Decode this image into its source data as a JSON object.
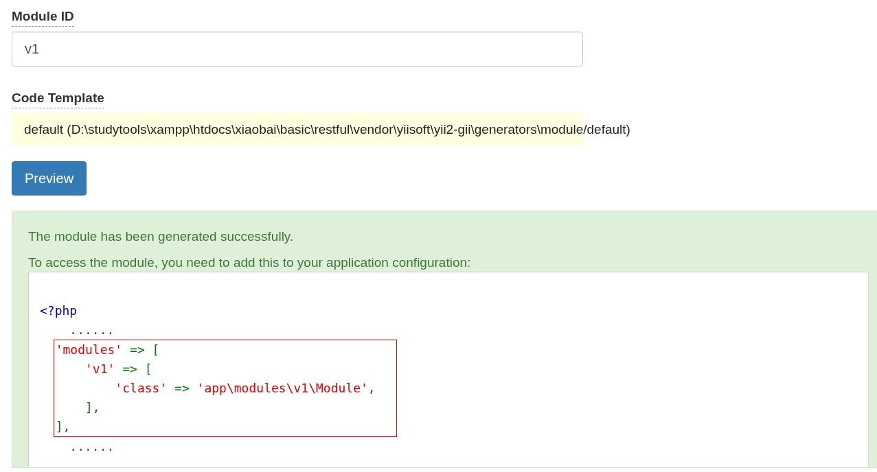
{
  "fields": [
    {
      "kind": "input",
      "label": "Module ID",
      "value": "v1"
    },
    {
      "kind": "sticky",
      "label": "Code Template",
      "value": "default (D:\\studytools\\xampp\\htdocs\\xiaobai\\basic\\restful\\vendor\\yiisoft\\yii2-gii\\generators\\module/default)"
    }
  ],
  "preview_button": "Preview",
  "alert": {
    "messages": [
      "The module has been generated successfully.",
      "To access the module, you need to add this to your application configuration:"
    ],
    "code_blocks": [
      {
        "kind": "plain",
        "lines": [
          [
            {
              "kind": "tag",
              "text": "<?php"
            }
          ],
          [
            {
              "kind": "punct",
              "text": "    ......"
            }
          ]
        ]
      },
      {
        "kind": "highlight",
        "lines": [
          [
            {
              "kind": "string",
              "text": "  'modules'"
            },
            {
              "kind": "punct",
              "text": " => ["
            }
          ],
          [
            {
              "kind": "string",
              "text": "      'v1'"
            },
            {
              "kind": "punct",
              "text": " => ["
            }
          ],
          [
            {
              "kind": "string",
              "text": "          'class'"
            },
            {
              "kind": "punct",
              "text": " => "
            },
            {
              "kind": "string",
              "text": "'app\\modules\\v1\\Module'"
            },
            {
              "kind": "punct",
              "text": ","
            }
          ],
          [
            {
              "kind": "punct",
              "text": "      ],"
            }
          ],
          [
            {
              "kind": "punct",
              "text": "  ],"
            }
          ]
        ]
      },
      {
        "kind": "plain",
        "lines": [
          [
            {
              "kind": "punct",
              "text": "    ......"
            }
          ]
        ]
      }
    ]
  }
}
